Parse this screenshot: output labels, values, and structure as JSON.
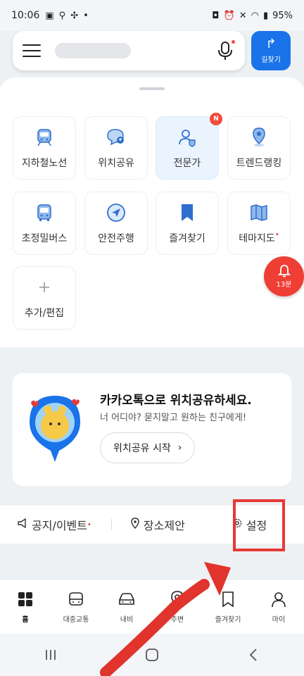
{
  "status_bar": {
    "time": "10:06",
    "battery": "95%"
  },
  "route_button": {
    "label": "길찾기"
  },
  "tiles": [
    {
      "label": "지하철노선",
      "icon": "subway-icon",
      "badge": "",
      "dot": ""
    },
    {
      "label": "위치공유",
      "icon": "location-share-icon",
      "badge": "",
      "dot": ""
    },
    {
      "label": "전문가",
      "icon": "expert-icon",
      "badge": "N",
      "dot": ""
    },
    {
      "label": "트렌드랭킹",
      "icon": "trend-ranking-icon",
      "badge": "",
      "dot": ""
    },
    {
      "label": "초정밀버스",
      "icon": "bus-icon",
      "badge": "",
      "dot": ""
    },
    {
      "label": "안전주행",
      "icon": "safe-driving-icon",
      "badge": "",
      "dot": ""
    },
    {
      "label": "즐겨찾기",
      "icon": "bookmark-icon",
      "badge": "",
      "dot": ""
    },
    {
      "label": "테마지도",
      "icon": "theme-map-icon",
      "badge": "",
      "dot": "•"
    },
    {
      "label": "추가/편집",
      "icon": "plus-icon",
      "badge": "",
      "dot": ""
    }
  ],
  "alarm": {
    "label": "13분"
  },
  "promo": {
    "title": "카카오톡으로 위치공유하세요.",
    "subtitle": "너 어디야? 묻지말고 원하는 친구에게!",
    "button_label": "위치공유 시작",
    "button_chevron": "›"
  },
  "links": {
    "notice": "공지/이벤트",
    "notice_dot": "•",
    "place": "장소제안",
    "settings": "설정"
  },
  "bottom_nav": [
    {
      "label": "홈",
      "icon": "home-grid-icon"
    },
    {
      "label": "대중교통",
      "icon": "transit-icon"
    },
    {
      "label": "내비",
      "icon": "car-icon"
    },
    {
      "label": "주변",
      "icon": "location-pin-icon"
    },
    {
      "label": "즐겨찾기",
      "icon": "bookmark-icon"
    },
    {
      "label": "마이",
      "icon": "person-icon"
    }
  ],
  "colors": {
    "accent": "#1a73e8",
    "alert": "#ef3f35",
    "highlight_box": "#e53935"
  }
}
